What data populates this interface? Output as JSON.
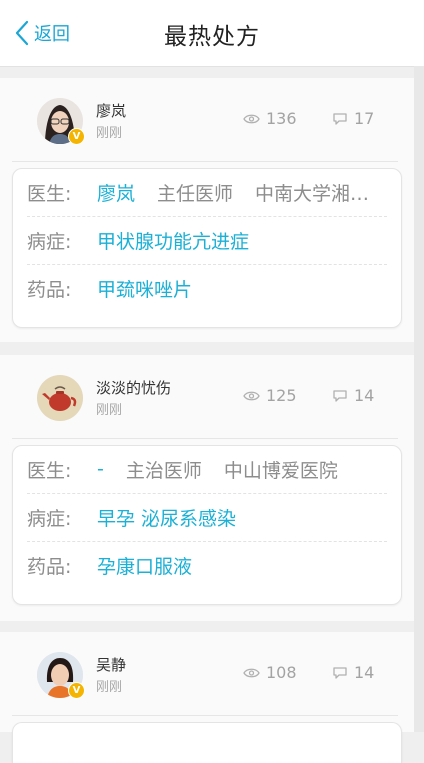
{
  "header": {
    "back_label": "返回",
    "title": "最热处方"
  },
  "labels": {
    "doctor": "医生:",
    "disease": "病症:",
    "drug": "药品:"
  },
  "posts": [
    {
      "user": "廖岚",
      "time": "刚刚",
      "views": "136",
      "comments": "17",
      "verified": true,
      "doctor_name": "廖岚",
      "doctor_title": "主任医师",
      "hospital": "中南大学湘雅医院",
      "disease": "甲状腺功能亢进症",
      "drug": "甲巯咪唑片"
    },
    {
      "user": "淡淡的忧伤",
      "time": "刚刚",
      "views": "125",
      "comments": "14",
      "verified": false,
      "doctor_name": "-",
      "doctor_title": "主治医师",
      "hospital": "中山博爱医院",
      "disease": "早孕 泌尿系感染",
      "drug": "孕康口服液"
    },
    {
      "user": "吴静",
      "time": "刚刚",
      "views": "108",
      "comments": "14",
      "verified": true
    }
  ],
  "colors": {
    "accent": "#1bb0d6",
    "badge": "#f5b400"
  },
  "icons": {
    "back": "chevron-left-icon",
    "views": "eye-icon",
    "comments": "comment-icon",
    "verified": "verified-badge-icon"
  }
}
